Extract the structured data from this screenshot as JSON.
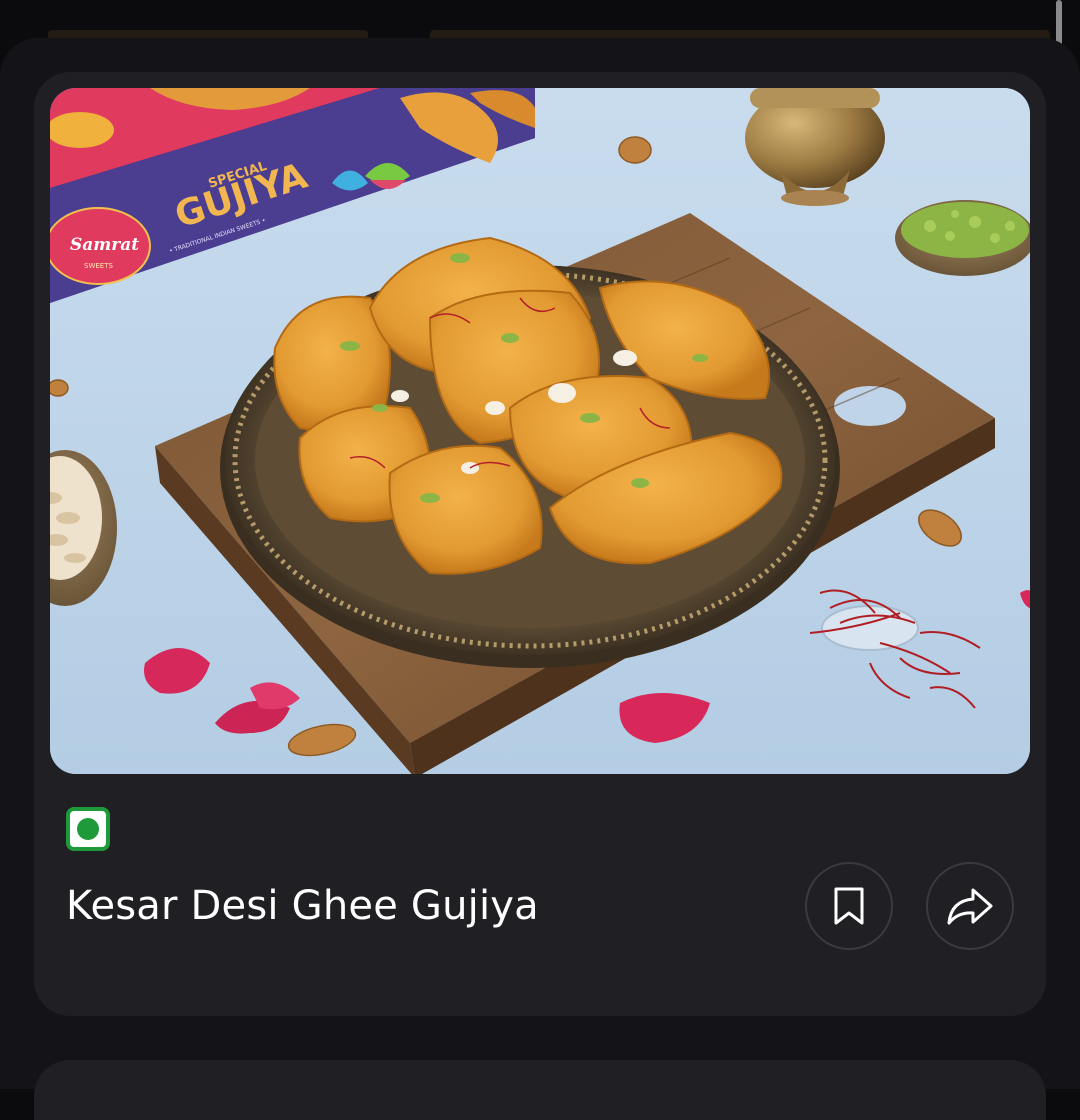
{
  "product": {
    "title": "Kesar Desi Ghee Gujiya",
    "image_alt": "Kesar Desi Ghee Gujiya",
    "diet": "veg",
    "diet_color": "#1f9a3b"
  },
  "packaging": {
    "brand": "Samrat",
    "brand_sub": "SWEETS",
    "line_top": "SPECIAL",
    "line_main": "GUJIYA",
    "tagline": "• TRADITIONAL INDIAN SWEETS •"
  },
  "actions": {
    "bookmark_icon": "bookmark-icon",
    "share_icon": "share-icon"
  },
  "colors": {
    "background": "#141418",
    "card": "#1f1f24",
    "text": "#ffffff",
    "veg_green": "#1f9a3b"
  }
}
